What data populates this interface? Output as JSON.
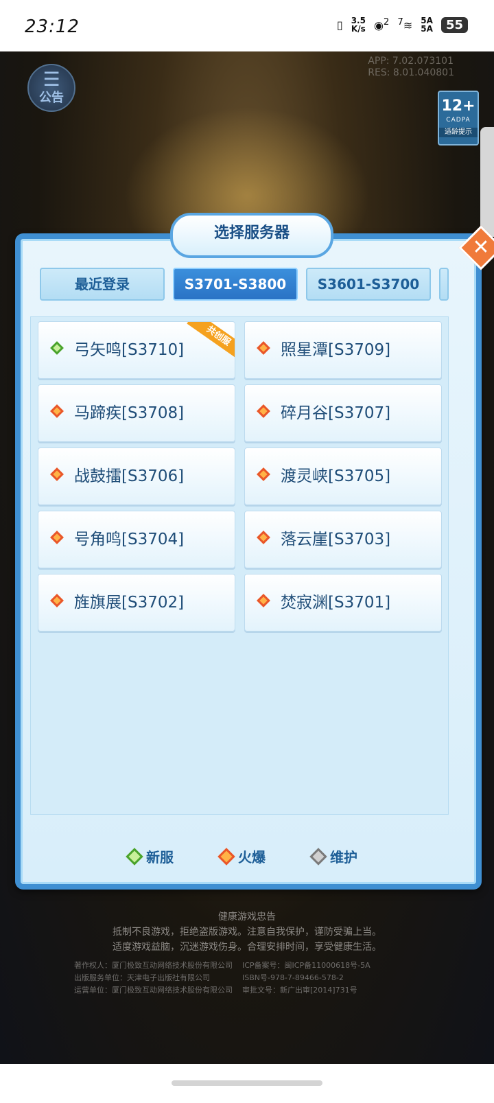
{
  "status_bar": {
    "time": "23:12",
    "net_speed_value": "3.5",
    "net_speed_unit": "K/s",
    "hotspot_badge": "2",
    "wifi_badge": "7",
    "signal_label_1": "5A",
    "signal_label_2": "5A",
    "battery": "55"
  },
  "scene": {
    "notice_label": "公告",
    "version_app": "APP:   7.02.073101",
    "version_res": "RES:   8.01.040801",
    "age_rating": "12+",
    "age_org": "CADPA",
    "age_tip": "适龄提示"
  },
  "dialog": {
    "title": "选择服务器",
    "close_symbol": "✕",
    "tabs": [
      {
        "label": "最近登录",
        "active": false
      },
      {
        "label": "S3701-S3800",
        "active": true
      },
      {
        "label": "S3601-S3700",
        "active": false
      }
    ],
    "servers": [
      {
        "name": "弓矢鸣[S3710]",
        "status": "new",
        "ribbon": "共创服"
      },
      {
        "name": "照星潭[S3709]",
        "status": "hot"
      },
      {
        "name": "马蹄疾[S3708]",
        "status": "hot"
      },
      {
        "name": "碎月谷[S3707]",
        "status": "hot"
      },
      {
        "name": "战鼓擂[S3706]",
        "status": "hot"
      },
      {
        "name": "渡灵峡[S3705]",
        "status": "hot"
      },
      {
        "name": "号角鸣[S3704]",
        "status": "hot"
      },
      {
        "name": "落云崖[S3703]",
        "status": "hot"
      },
      {
        "name": "旌旗展[S3702]",
        "status": "hot"
      },
      {
        "name": "焚寂渊[S3701]",
        "status": "hot"
      }
    ],
    "legend": {
      "new": "新服",
      "hot": "火爆",
      "maintenance": "维护"
    }
  },
  "footer": {
    "health_title": "健康游戏忠告",
    "health_line1": "抵制不良游戏，拒绝盗版游戏。注意自我保护，谨防受骗上当。",
    "health_line2": "适度游戏益脑，沉迷游戏伤身。合理安排时间，享受健康生活。",
    "copyright": "著作权人：厦门极致互动网络技术股份有限公司",
    "publisher": "出版服务单位：天津电子出版社有限公司",
    "operator": "运营单位：厦门极致互动网络技术股份有限公司",
    "icp": "ICP备案号：闽ICP备11000618号-5A",
    "isbn": "ISBN号-978-7-89466-578-2",
    "approval": "审批文号：新广出审[2014]731号"
  },
  "colors": {
    "accent": "#3f8fd2",
    "hot": "#e9562a",
    "new": "#4aa32c",
    "maintenance": "#7a7a7a"
  }
}
